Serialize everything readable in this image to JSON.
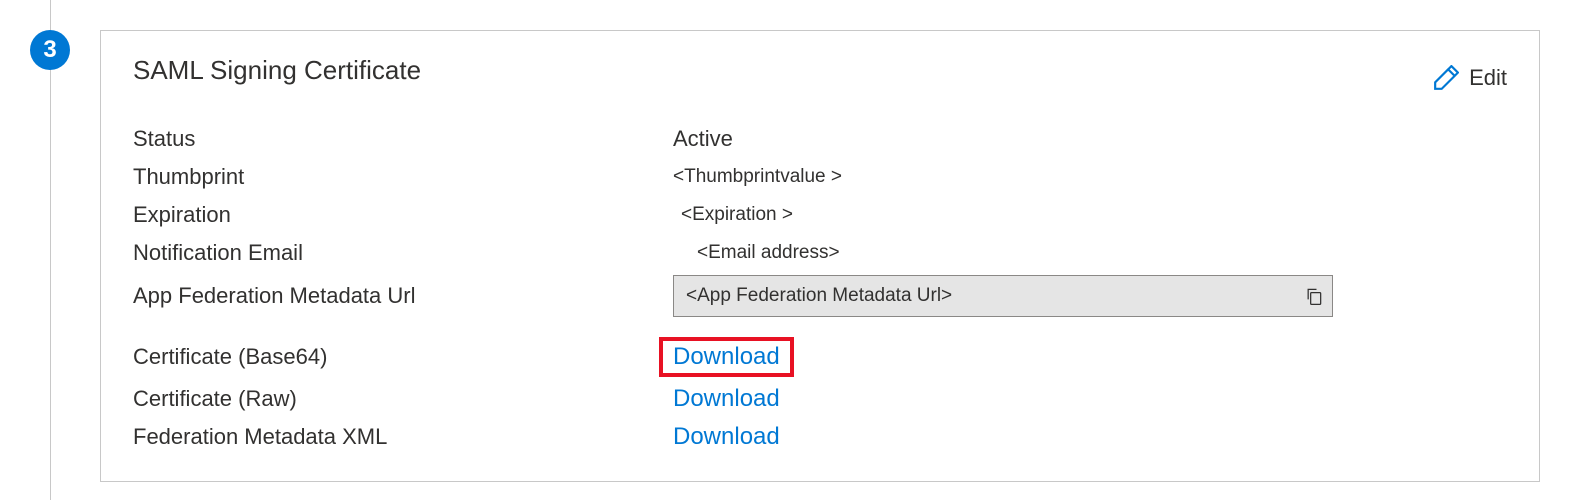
{
  "step": {
    "number": "3"
  },
  "card": {
    "title": "SAML Signing Certificate",
    "edit_label": "Edit"
  },
  "fields": {
    "status": {
      "label": "Status",
      "value": "Active"
    },
    "thumbprint": {
      "label": "Thumbprint",
      "value": "<Thumbprintvalue >"
    },
    "expiration": {
      "label": "Expiration",
      "value": "<Expiration >"
    },
    "notification_email": {
      "label": "Notification Email",
      "value": "<Email address>"
    },
    "federation_url": {
      "label": "App Federation Metadata Url",
      "value": "<App Federation Metadata Url>"
    },
    "cert_base64": {
      "label": "Certificate (Base64)",
      "link": "Download"
    },
    "cert_raw": {
      "label": "Certificate (Raw)",
      "link": "Download"
    },
    "metadata_xml": {
      "label": "Federation Metadata XML",
      "link": "Download"
    }
  }
}
